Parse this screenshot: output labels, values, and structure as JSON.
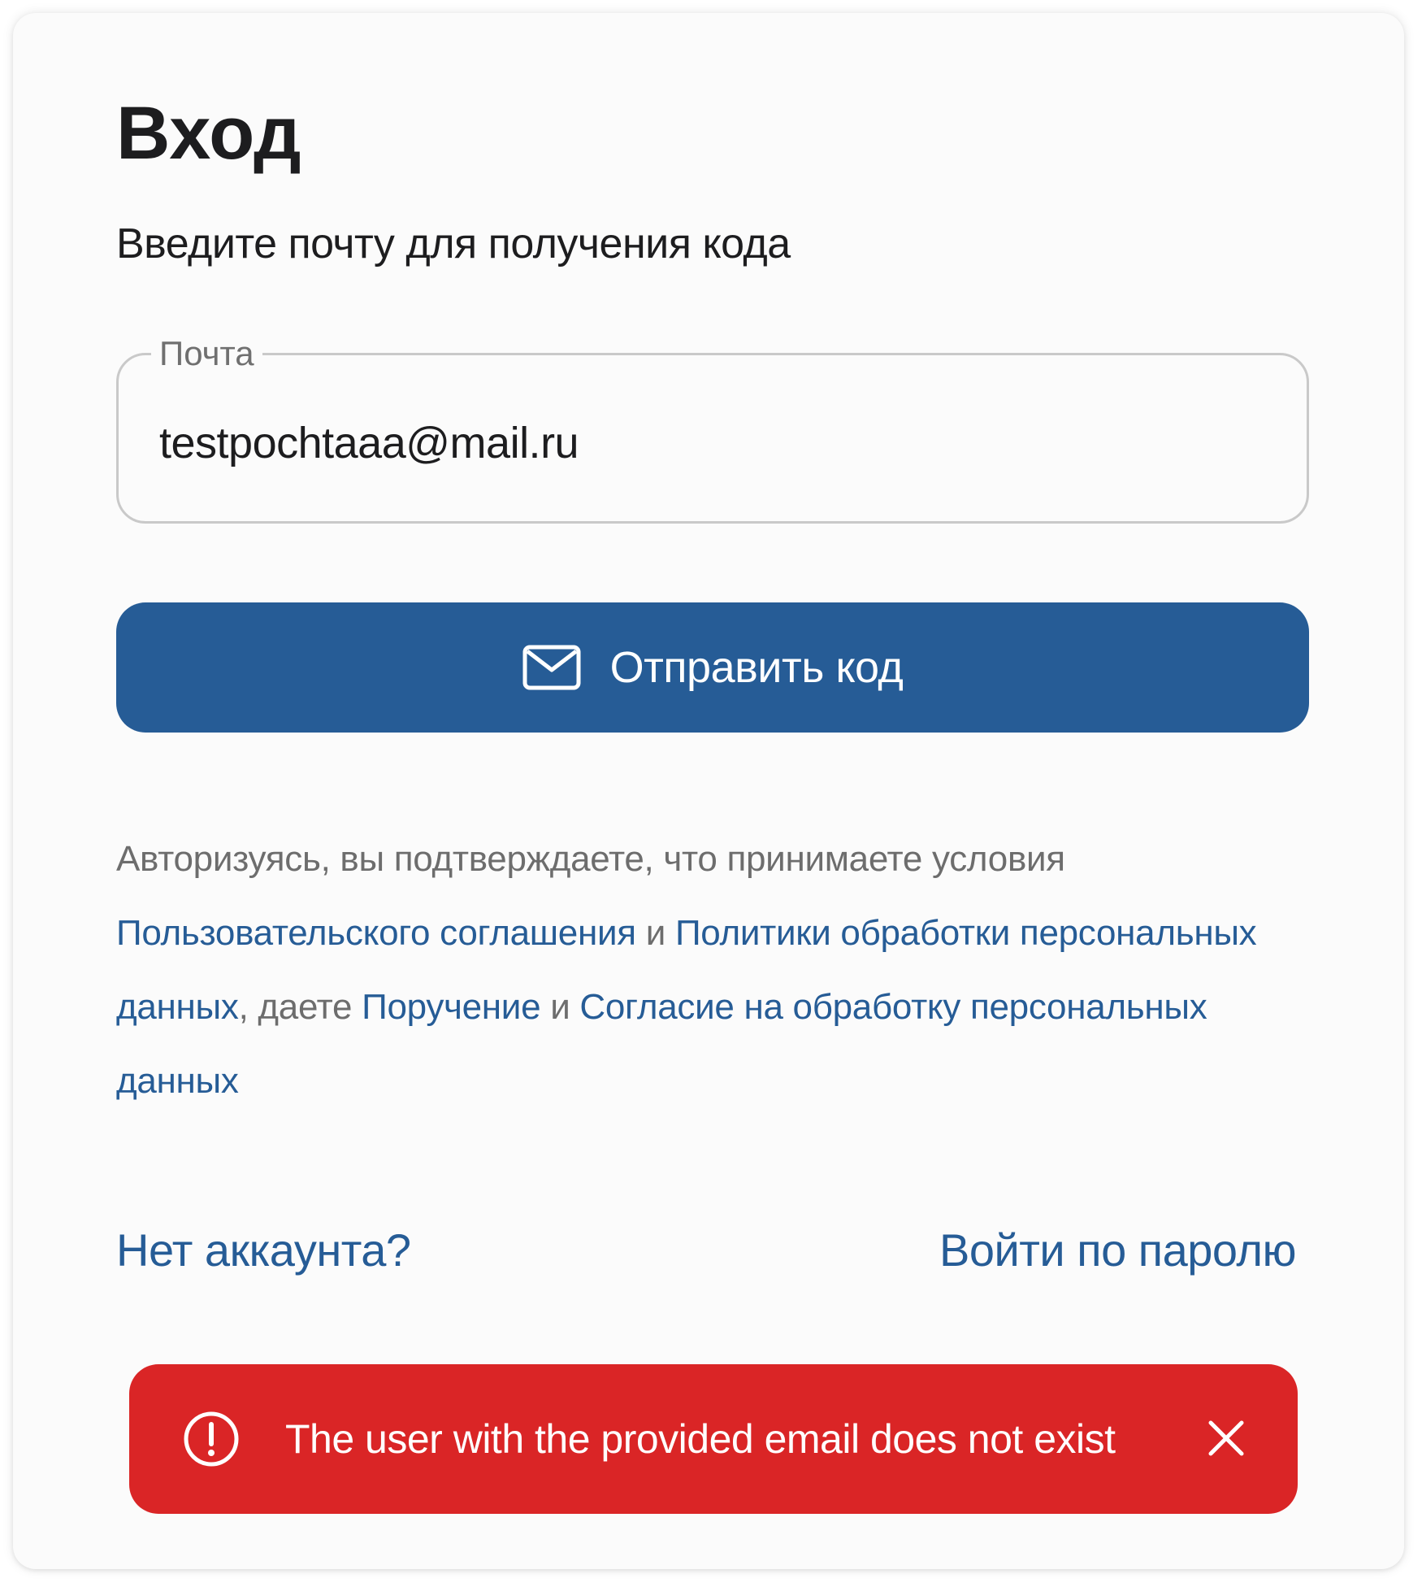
{
  "login": {
    "title": "Вход",
    "subtitle": "Введите почту для получения кода"
  },
  "email_field": {
    "label": "Почта",
    "value": "testpochtaaa@mail.ru"
  },
  "send_button": {
    "label": "Отправить код",
    "icon": "mail-icon"
  },
  "terms": {
    "text_1": "Авторизуясь, вы подтверждаете, что принимаете условия ",
    "link_user_agreement": "Пользовательского соглашения",
    "text_and_1": " и ",
    "link_privacy_policy": "Политики обработки персональных данных",
    "text_give": ", даете ",
    "link_instruction": "Поручение",
    "text_and_2": " и ",
    "link_consent": "Согласие на обработку персональных данных"
  },
  "links": {
    "no_account": "Нет аккаунта?",
    "password_login": "Войти по паролю"
  },
  "toast": {
    "message": "The user with the provided email does not exist",
    "icon": "alert-circle-icon",
    "close_icon": "close-icon"
  },
  "colors": {
    "primary": "#265c96",
    "error": "#da2526",
    "text": "#1d1d1f",
    "muted": "#6d6d6d"
  }
}
